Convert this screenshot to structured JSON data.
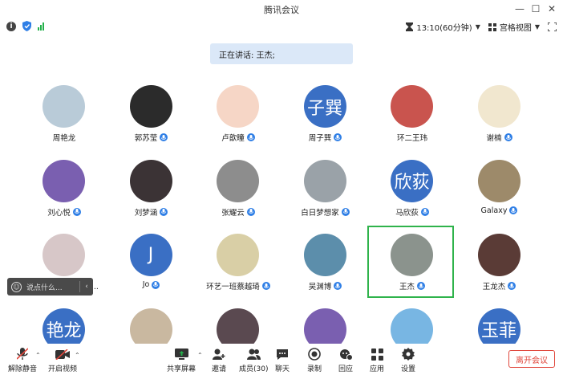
{
  "window": {
    "title": "腾讯会议"
  },
  "infobar": {
    "time": "13:10(60分钟)",
    "view_label": "宫格视图"
  },
  "speaking_banner": "正在讲话: 王杰;",
  "participants": [
    {
      "name": "周艳龙",
      "avatar_text": "",
      "color": "#b9cbd8",
      "mic": false
    },
    {
      "name": "郭苏莹",
      "avatar_text": "",
      "color": "#2b2b2b",
      "mic": true
    },
    {
      "name": "卢歆瞳",
      "avatar_text": "",
      "color": "#f6d6c6",
      "mic": true
    },
    {
      "name": "周子巽",
      "avatar_text": "子巽",
      "color": "#3a6fc4",
      "mic": true
    },
    {
      "name": "环二王玮",
      "avatar_text": "",
      "color": "#c9544e",
      "mic": false
    },
    {
      "name": "谢楠",
      "avatar_text": "",
      "color": "#f1e7cf",
      "mic": true
    },
    {
      "name": "刘心悦",
      "avatar_text": "",
      "color": "#7a5fb0",
      "mic": true
    },
    {
      "name": "刘梦涵",
      "avatar_text": "",
      "color": "#3b3335",
      "mic": true
    },
    {
      "name": "张耀云",
      "avatar_text": "",
      "color": "#8d8d8d",
      "mic": true
    },
    {
      "name": "白日梦想家",
      "avatar_text": "",
      "color": "#9aa2a8",
      "mic": true
    },
    {
      "name": "马欣荻",
      "avatar_text": "欣荻",
      "color": "#3a6fc4",
      "mic": true
    },
    {
      "name": "Galaxy",
      "avatar_text": "",
      "color": "#9d8a6a",
      "mic": true
    },
    {
      "name": "赵琳琳20221410...",
      "avatar_text": "",
      "color": "#d7c7c8",
      "mic": false
    },
    {
      "name": "Jo",
      "avatar_text": "J",
      "color": "#3a6fc4",
      "mic": true
    },
    {
      "name": "环艺一班蔡越琦",
      "avatar_text": "",
      "color": "#d9cfa6",
      "mic": true
    },
    {
      "name": "吴渊博",
      "avatar_text": "",
      "color": "#5c8eab",
      "mic": true
    },
    {
      "name": "王杰",
      "avatar_text": "",
      "color": "#8b938d",
      "mic": true
    },
    {
      "name": "王龙杰",
      "avatar_text": "",
      "color": "#5a3b36",
      "mic": true
    },
    {
      "name": "",
      "avatar_text": "艳龙",
      "color": "#3a6fc4",
      "mic": false
    },
    {
      "name": "",
      "avatar_text": "",
      "color": "#c9b8a0",
      "mic": false
    },
    {
      "name": "",
      "avatar_text": "",
      "color": "#5a4950",
      "mic": false
    },
    {
      "name": "",
      "avatar_text": "",
      "color": "#7a5fb0",
      "mic": false
    },
    {
      "name": "",
      "avatar_text": "",
      "color": "#78b6e3",
      "mic": false
    },
    {
      "name": "",
      "avatar_text": "玉菲",
      "color": "#3a6fc4",
      "mic": false
    }
  ],
  "chat_toast": {
    "placeholder": "说点什么..."
  },
  "toolbar": {
    "unmute": "解除静音",
    "start_video": "开启视频",
    "share_screen": "共享屏幕",
    "invite": "邀请",
    "members": "成员(30)",
    "chat": "聊天",
    "record": "录制",
    "replay": "回应",
    "apps": "应用",
    "settings": "设置",
    "leave": "离开会议"
  }
}
